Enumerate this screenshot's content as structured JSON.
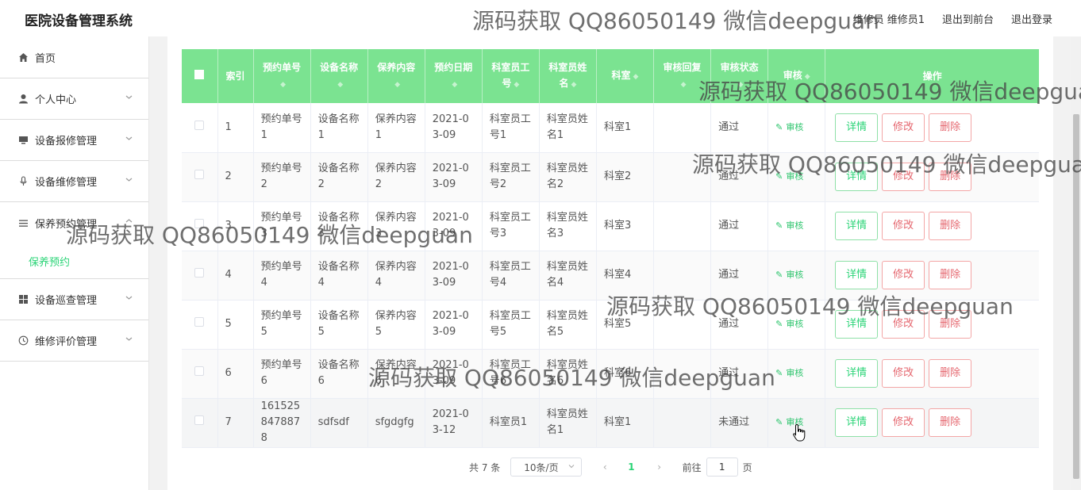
{
  "header": {
    "brand": "医院设备管理系统",
    "user_label": "维修员 维修员1",
    "link_front": "退出到前台",
    "link_logout": "退出登录"
  },
  "sidebar": {
    "items": [
      {
        "label": "首页",
        "icon": "home-icon"
      },
      {
        "label": "个人中心",
        "icon": "user-icon"
      },
      {
        "label": "设备报修管理",
        "icon": "monitor-icon"
      },
      {
        "label": "设备维修管理",
        "icon": "mic-icon"
      },
      {
        "label": "保养预约管理",
        "icon": "list-icon",
        "sub": "保养预约"
      },
      {
        "label": "设备巡查管理",
        "icon": "grid-icon"
      },
      {
        "label": "维修评价管理",
        "icon": "clock-icon"
      }
    ]
  },
  "table": {
    "headers": [
      "索引",
      "预约单号",
      "设备名称",
      "保养内容",
      "预约日期",
      "科室员工号",
      "科室员姓名",
      "科室",
      "审核回复",
      "审核状态",
      "审核",
      "操作"
    ],
    "audit_label": "审核",
    "buttons": {
      "detail": "详情",
      "edit": "修改",
      "delete": "删除"
    },
    "rows": [
      {
        "idx": "1",
        "order": "预约单号1",
        "device": "设备名称1",
        "content": "保养内容1",
        "date": "2021-03-09",
        "staff_no": "科室员工号1",
        "staff_name": "科室员姓名1",
        "dept": "科室1",
        "reply": "",
        "status": "通过"
      },
      {
        "idx": "2",
        "order": "预约单号2",
        "device": "设备名称2",
        "content": "保养内容2",
        "date": "2021-03-09",
        "staff_no": "科室员工号2",
        "staff_name": "科室员姓名2",
        "dept": "科室2",
        "reply": "",
        "status": "通过"
      },
      {
        "idx": "3",
        "order": "预约单号3",
        "device": "设备名称3",
        "content": "保养内容3",
        "date": "2021-03-09",
        "staff_no": "科室员工号3",
        "staff_name": "科室员姓名3",
        "dept": "科室3",
        "reply": "",
        "status": "通过"
      },
      {
        "idx": "4",
        "order": "预约单号4",
        "device": "设备名称4",
        "content": "保养内容4",
        "date": "2021-03-09",
        "staff_no": "科室员工号4",
        "staff_name": "科室员姓名4",
        "dept": "科室4",
        "reply": "",
        "status": "通过"
      },
      {
        "idx": "5",
        "order": "预约单号5",
        "device": "设备名称5",
        "content": "保养内容5",
        "date": "2021-03-09",
        "staff_no": "科室员工号5",
        "staff_name": "科室员姓名5",
        "dept": "科室5",
        "reply": "",
        "status": "通过"
      },
      {
        "idx": "6",
        "order": "预约单号6",
        "device": "设备名称6",
        "content": "保养内容6",
        "date": "2021-03-09",
        "staff_no": "科室员工号6",
        "staff_name": "科室员姓名6",
        "dept": "科室6",
        "reply": "",
        "status": "通过"
      },
      {
        "idx": "7",
        "order": "1615258478878",
        "device": "sdfsdf",
        "content": "sfgdgfg",
        "date": "2021-03-12",
        "staff_no": "科室员1",
        "staff_name": "科室员姓名1",
        "dept": "科室1",
        "reply": "",
        "status": "未通过"
      }
    ]
  },
  "pagination": {
    "total": "共 7 条",
    "page_size": "10条/页",
    "current": "1",
    "goto_prefix": "前往",
    "goto_value": "1",
    "goto_suffix": "页"
  },
  "watermark": "源码获取 QQ86050149 微信deepguan",
  "colors": {
    "accent": "#2bd477",
    "header_bg": "#7be391",
    "danger": "#e5676f"
  }
}
